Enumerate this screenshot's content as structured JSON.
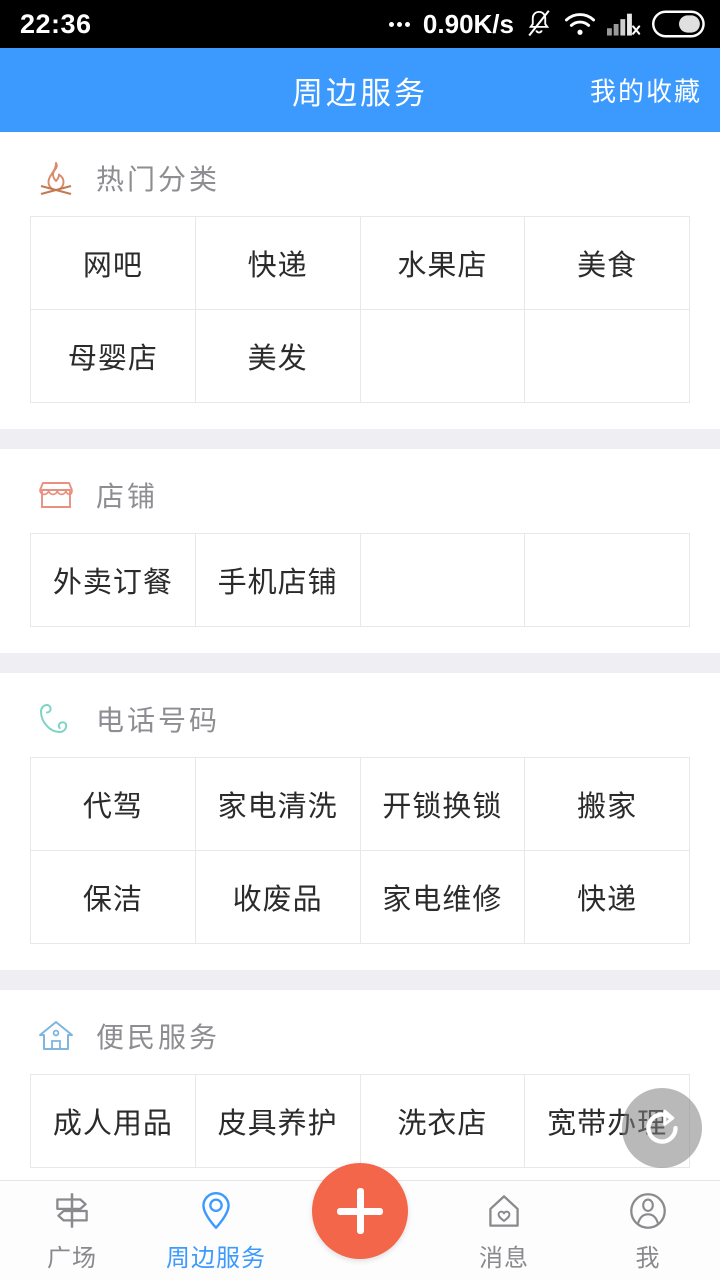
{
  "status_bar": {
    "time": "22:36",
    "network_speed": "0.90K/s",
    "icons": [
      "more-dots-icon",
      "mute-bell-icon",
      "wifi-icon",
      "signal-no-service-icon",
      "battery-icon"
    ]
  },
  "header": {
    "title": "周边服务",
    "action_label": "我的收藏",
    "background_color": "#3c9aff"
  },
  "sections": [
    {
      "title": "热门分类",
      "icon": "campfire-icon",
      "icon_color": "#d98a6a",
      "items": [
        "网吧",
        "快递",
        "水果店",
        "美食",
        "母婴店",
        "美发",
        "",
        ""
      ]
    },
    {
      "title": "店铺",
      "icon": "storefront-icon",
      "icon_color": "#e8917e",
      "items": [
        "外卖订餐",
        "手机店铺",
        "",
        ""
      ]
    },
    {
      "title": "电话号码",
      "icon": "phone-handset-icon",
      "icon_color": "#7fd4c4",
      "items": [
        "代驾",
        "家电清洗",
        "开锁换锁",
        "搬家",
        "保洁",
        "收废品",
        "家电维修",
        "快递"
      ]
    },
    {
      "title": "便民服务",
      "icon": "house-icon",
      "icon_color": "#7fb6dd",
      "items": [
        "成人用品",
        "皮具养护",
        "洗衣店",
        "宽带办理"
      ]
    }
  ],
  "floating_refresh": {
    "icon": "refresh-icon",
    "background_color": "rgba(128,128,128,0.55)"
  },
  "tabbar": {
    "active_color": "#3c9aff",
    "inactive_color": "#8a8a8e",
    "fab_color": "#f4664a",
    "items": [
      {
        "label": "广场",
        "icon": "signpost-icon",
        "active": false
      },
      {
        "label": "周边服务",
        "icon": "location-pin-icon",
        "active": true
      },
      {
        "label": "",
        "icon": "plus-icon",
        "active": false
      },
      {
        "label": "消息",
        "icon": "house-heart-icon",
        "active": false
      },
      {
        "label": "我",
        "icon": "person-circle-icon",
        "active": false
      }
    ]
  }
}
